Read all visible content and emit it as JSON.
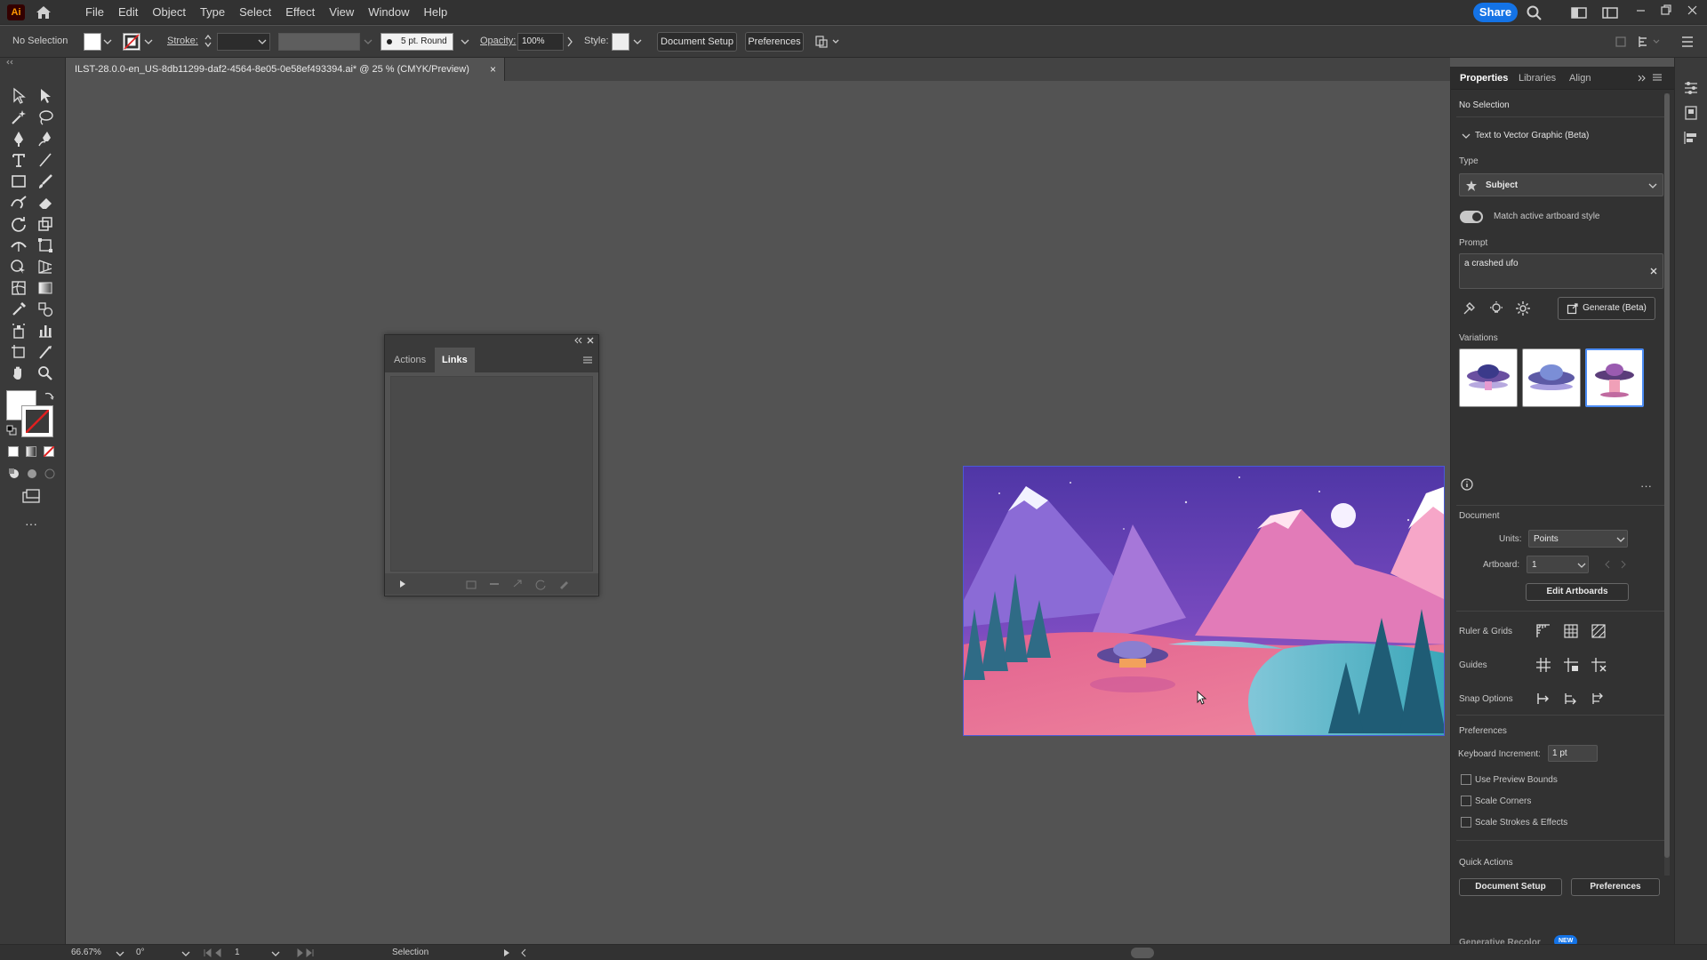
{
  "app": {
    "logo": "Ai"
  },
  "menu": {
    "items": [
      "File",
      "Edit",
      "Object",
      "Type",
      "Select",
      "Effect",
      "View",
      "Window",
      "Help"
    ]
  },
  "share": {
    "label": "Share"
  },
  "control_bar": {
    "selection": "No Selection",
    "stroke_label": "Stroke:",
    "brush": "5 pt. Round",
    "opacity_label": "Opacity:",
    "opacity_value": "100%",
    "style_label": "Style:",
    "document_setup": "Document Setup",
    "preferences": "Preferences"
  },
  "document_tab": {
    "title": "ILST-28.0.0-en_US-8db11299-daf2-4564-8e05-0e58ef493394.ai* @ 25 % (CMYK/Preview)",
    "close": "×"
  },
  "floating_panel": {
    "tabs": [
      "Actions",
      "Links"
    ],
    "active_tab": "Links"
  },
  "properties": {
    "tabs": [
      "Properties",
      "Libraries",
      "Align"
    ],
    "selection": "No Selection",
    "t2v_section": "Text to Vector Graphic (Beta)",
    "type_label": "Type",
    "type_value": "Subject",
    "match_style": "Match active artboard style",
    "match_style_on": true,
    "prompt_label": "Prompt",
    "prompt_value": "a crashed ufo",
    "generate": "Generate (Beta)",
    "variations_label": "Variations",
    "document_label": "Document",
    "units_label": "Units:",
    "units_value": "Points",
    "artboard_label": "Artboard:",
    "artboard_value": "1",
    "edit_artboards": "Edit Artboards",
    "ruler_grids": "Ruler & Grids",
    "guides": "Guides",
    "snap_options": "Snap Options",
    "preferences_label": "Preferences",
    "keyboard_increment_label": "Keyboard Increment:",
    "keyboard_increment_value": "1 pt",
    "use_preview_bounds": "Use Preview Bounds",
    "scale_corners": "Scale Corners",
    "scale_strokes": "Scale Strokes & Effects",
    "quick_actions": "Quick Actions",
    "qa_document_setup": "Document Setup",
    "qa_preferences": "Preferences",
    "generative_recolor": "Generative Recolor",
    "new_badge": "NEW"
  },
  "status_bar": {
    "zoom": "66.67%",
    "rotation": "0°",
    "artboard": "1",
    "tool": "Selection"
  },
  "colors": {
    "accent": "#1473e6",
    "selection_border": "#4b8cf5",
    "sky_top": "#5a3aa8",
    "ground_pink": "#e96a94"
  }
}
